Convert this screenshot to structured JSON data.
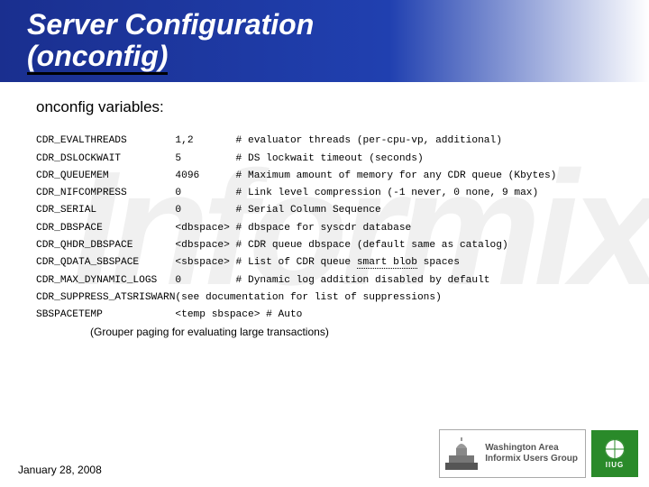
{
  "header": {
    "title_line1": "Server Configuration",
    "title_line2": "(onconfig)"
  },
  "subtitle": "onconfig variables:",
  "config_rows": [
    {
      "name": "CDR_EVALTHREADS",
      "value": "1,2",
      "comment": "# evaluator threads (per-cpu-vp, additional)"
    },
    {
      "name": "CDR_DSLOCKWAIT",
      "value": "5",
      "comment": "# DS lockwait timeout (seconds)"
    },
    {
      "name": "CDR_QUEUEMEM",
      "value": "4096",
      "comment": "# Maximum amount of memory for any CDR queue (Kbytes)"
    },
    {
      "name": "CDR_NIFCOMPRESS",
      "value": "0",
      "comment": "# Link level compression (-1 never, 0 none, 9 max)"
    },
    {
      "name": "CDR_SERIAL",
      "value": "0",
      "comment": "# Serial Column Sequence"
    },
    {
      "name": "CDR_DBSPACE",
      "value": "<dbspace>",
      "comment": "# dbspace for syscdr database"
    },
    {
      "name": "CDR_QHDR_DBSPACE",
      "value": "<dbspace>",
      "comment": "# CDR queue dbspace (default same as catalog)"
    },
    {
      "name": "CDR_QDATA_SBSPACE",
      "value": "<sbspace>",
      "comment": "# List of CDR queue smart blob spaces"
    },
    {
      "name": "CDR_MAX_DYNAMIC_LOGS",
      "value": "0",
      "comment": "# Dynamic log addition disabled by default"
    },
    {
      "name": "CDR_SUPPRESS_ATSRISWARN",
      "value": "(see documentation for list of suppressions)",
      "comment": ""
    },
    {
      "name": "SBSPACETEMP",
      "value": "<temp sbspace>",
      "comment": "# Auto"
    }
  ],
  "note": "(Grouper paging for evaluating large transactions)",
  "footer_date": "January 28, 2008",
  "waiug": {
    "line1": "Washington Area",
    "line2": "Informix Users Group"
  },
  "iiug_label": "IIUG",
  "watermark": "Informix"
}
